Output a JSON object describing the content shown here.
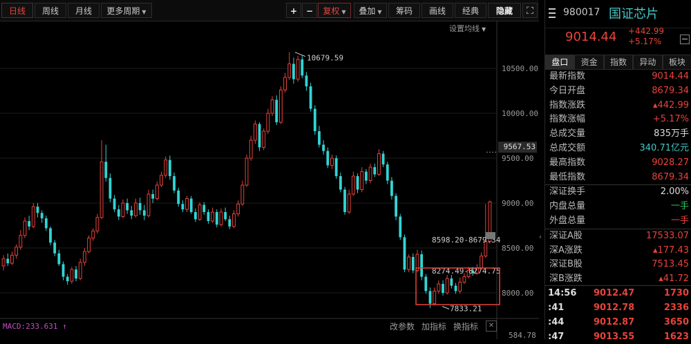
{
  "toolbar": {
    "periods": [
      "日线",
      "周线",
      "月线",
      "更多周期"
    ],
    "plus": "+",
    "minus": "−",
    "adjust": "复权",
    "overlay": "叠加",
    "chips": "筹码",
    "draw": "画线",
    "classic": "经典",
    "hide": "隐藏",
    "fullscreen_icon": "fullscreen-icon"
  },
  "chart_panel": {
    "set_ma": "设置均线",
    "indicator": "MACD:233.631 ↑",
    "change_params": "改参数",
    "add_indicator": "加指标",
    "switch_indicator": "换指标",
    "current_price_label": "9567.53",
    "macd_axis_label": "584.78"
  },
  "chart_data": {
    "type": "candlestick",
    "y_ticks": [
      "10500.00",
      "10000.00",
      "9500.00",
      "9000.00",
      "8500.00",
      "8000.00"
    ],
    "ylim": [
      7770,
      10830
    ],
    "annotations": {
      "high": "10679.59",
      "low": "7833.21",
      "range1": "8598.20-8679.34",
      "range2": "8274.49-8274.75"
    },
    "colors": {
      "up": "#e8433b",
      "down": "#32d4d4"
    },
    "candles": [
      [
        8300,
        8380,
        8250,
        8420
      ],
      [
        8380,
        8330,
        8300,
        8440
      ],
      [
        8330,
        8420,
        8310,
        8460
      ],
      [
        8420,
        8510,
        8380,
        8540
      ],
      [
        8510,
        8640,
        8480,
        8700
      ],
      [
        8640,
        8800,
        8610,
        8840
      ],
      [
        8800,
        8740,
        8700,
        8860
      ],
      [
        8740,
        8960,
        8720,
        9000
      ],
      [
        8960,
        8890,
        8840,
        9000
      ],
      [
        8890,
        8830,
        8780,
        8920
      ],
      [
        8830,
        8720,
        8690,
        8860
      ],
      [
        8720,
        8560,
        8530,
        8740
      ],
      [
        8560,
        8440,
        8410,
        8590
      ],
      [
        8440,
        8320,
        8300,
        8480
      ],
      [
        8320,
        8180,
        8140,
        8350
      ],
      [
        8180,
        8130,
        8090,
        8210
      ],
      [
        8130,
        8260,
        8100,
        8290
      ],
      [
        8260,
        8160,
        8130,
        8300
      ],
      [
        8160,
        8340,
        8140,
        8380
      ],
      [
        8340,
        8460,
        8300,
        8500
      ],
      [
        8460,
        8610,
        8440,
        8640
      ],
      [
        8610,
        8690,
        8580,
        8720
      ],
      [
        8690,
        8840,
        8660,
        8880
      ],
      [
        8840,
        9460,
        8820,
        9700
      ],
      [
        9460,
        9280,
        9240,
        9650
      ],
      [
        9280,
        9050,
        9010,
        9330
      ],
      [
        9050,
        8930,
        8900,
        9090
      ],
      [
        8930,
        8850,
        8810,
        8980
      ],
      [
        8850,
        9000,
        8830,
        9040
      ],
      [
        9000,
        8920,
        8880,
        9050
      ],
      [
        8920,
        8860,
        8820,
        8970
      ],
      [
        8860,
        9000,
        8840,
        9050
      ],
      [
        9000,
        8920,
        8870,
        9060
      ],
      [
        8920,
        8860,
        8810,
        8980
      ],
      [
        8860,
        9100,
        8840,
        9150
      ],
      [
        9100,
        9050,
        9000,
        9150
      ],
      [
        9050,
        9200,
        9030,
        9240
      ],
      [
        9200,
        9310,
        9180,
        9350
      ],
      [
        9310,
        9480,
        9280,
        9520
      ],
      [
        9480,
        9300,
        9260,
        9530
      ],
      [
        9300,
        9140,
        9110,
        9340
      ],
      [
        9140,
        8990,
        8960,
        9170
      ],
      [
        8990,
        8930,
        8900,
        9030
      ],
      [
        8930,
        9050,
        8900,
        9080
      ],
      [
        9050,
        8900,
        8880,
        9080
      ],
      [
        8900,
        8820,
        8790,
        8940
      ],
      [
        8820,
        8980,
        8800,
        9010
      ],
      [
        8980,
        8900,
        8870,
        9010
      ],
      [
        8900,
        8800,
        8770,
        8930
      ],
      [
        8800,
        8900,
        8780,
        8950
      ],
      [
        8900,
        8760,
        8730,
        8930
      ],
      [
        8760,
        8900,
        8740,
        8940
      ],
      [
        8900,
        8820,
        8800,
        8950
      ],
      [
        8820,
        8740,
        8710,
        8860
      ],
      [
        8740,
        8880,
        8720,
        8920
      ],
      [
        8880,
        8990,
        8850,
        9030
      ],
      [
        8990,
        9200,
        8970,
        9250
      ],
      [
        9200,
        9500,
        9180,
        9540
      ],
      [
        9500,
        9700,
        9470,
        9750
      ],
      [
        9700,
        9880,
        9660,
        9920
      ],
      [
        9880,
        9620,
        9580,
        9900
      ],
      [
        9620,
        9800,
        9590,
        9830
      ],
      [
        9800,
        10000,
        9770,
        10050
      ],
      [
        10000,
        10150,
        9970,
        10190
      ],
      [
        10150,
        9900,
        9870,
        10200
      ],
      [
        9900,
        10260,
        9880,
        10300
      ],
      [
        10260,
        10400,
        10230,
        10450
      ],
      [
        10400,
        10550,
        10370,
        10680
      ],
      [
        10550,
        10380,
        10330,
        10620
      ],
      [
        10380,
        10600,
        10350,
        10640
      ],
      [
        10600,
        10420,
        10390,
        10650
      ],
      [
        10420,
        10300,
        10250,
        10460
      ],
      [
        10300,
        10050,
        10020,
        10340
      ],
      [
        10050,
        9800,
        9760,
        10090
      ],
      [
        9800,
        9650,
        9620,
        9860
      ],
      [
        9650,
        9580,
        9540,
        9700
      ],
      [
        9580,
        9420,
        9390,
        9620
      ],
      [
        9420,
        9500,
        9380,
        9540
      ],
      [
        9500,
        9300,
        9270,
        9530
      ],
      [
        9300,
        9150,
        9120,
        9340
      ],
      [
        9150,
        8900,
        8870,
        9180
      ],
      [
        8900,
        9100,
        8880,
        9150
      ],
      [
        9100,
        9300,
        9080,
        9350
      ],
      [
        9300,
        9150,
        9110,
        9330
      ],
      [
        9150,
        9350,
        9120,
        9400
      ],
      [
        9350,
        9250,
        9210,
        9380
      ],
      [
        9250,
        9400,
        9220,
        9440
      ],
      [
        9400,
        9320,
        9290,
        9440
      ],
      [
        9320,
        9550,
        9300,
        9600
      ],
      [
        9550,
        9430,
        9400,
        9580
      ],
      [
        9430,
        9250,
        9210,
        9460
      ],
      [
        9250,
        9080,
        9040,
        9290
      ],
      [
        9080,
        8850,
        8810,
        9110
      ],
      [
        8850,
        8620,
        8590,
        8880
      ],
      [
        8620,
        8260,
        8230,
        8650
      ],
      [
        8260,
        8400,
        8230,
        8430
      ],
      [
        8400,
        8250,
        8220,
        8440
      ],
      [
        8250,
        8430,
        8230,
        8480
      ],
      [
        8430,
        8180,
        8140,
        8470
      ],
      [
        8180,
        8020,
        7990,
        8210
      ],
      [
        8020,
        7880,
        7833,
        8060
      ],
      [
        7880,
        8020,
        7860,
        8060
      ],
      [
        8020,
        8100,
        7990,
        8140
      ],
      [
        8100,
        8000,
        7970,
        8140
      ],
      [
        8000,
        8160,
        7980,
        8200
      ],
      [
        8160,
        8080,
        8050,
        8200
      ],
      [
        8080,
        8020,
        7990,
        8110
      ],
      [
        8020,
        8120,
        7990,
        8170
      ],
      [
        8120,
        8180,
        8100,
        8220
      ],
      [
        8180,
        8250,
        8160,
        8290
      ],
      [
        8250,
        8220,
        8190,
        8290
      ],
      [
        8220,
        8280,
        8200,
        8320
      ],
      [
        8280,
        8410,
        8260,
        8450
      ],
      [
        8410,
        8574,
        8390,
        8990
      ],
      [
        8574,
        9014,
        8550,
        9030
      ]
    ]
  }
}
